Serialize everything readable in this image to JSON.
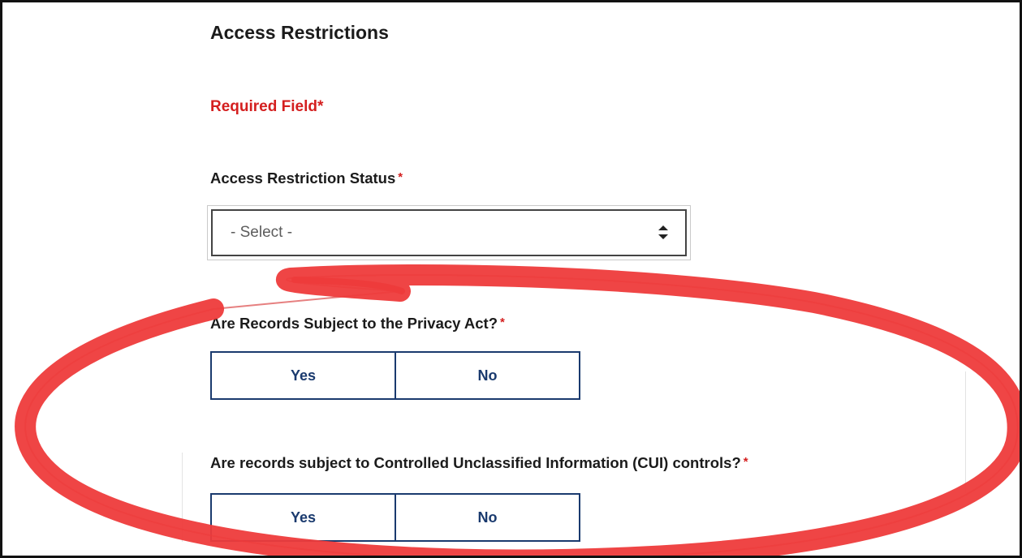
{
  "section": {
    "title": "Access Restrictions"
  },
  "required_note": {
    "text": "Required Field*",
    "color": "#d41f1f"
  },
  "access_status": {
    "label": "Access Restriction Status",
    "required_marker": "*",
    "selected_value": "- Select -"
  },
  "privacy_act": {
    "label": "Are Records Subject to the Privacy Act?",
    "required_marker": "*",
    "options": [
      "Yes",
      "No"
    ]
  },
  "cui": {
    "label": "Are records subject to Controlled Unclassified Information (CUI) controls?",
    "required_marker": "*",
    "options": [
      "Yes",
      "No"
    ]
  },
  "colors": {
    "required": "#d41f1f",
    "button_text": "#1a3a6e",
    "annotation": "#ee3b3b"
  },
  "icons": {
    "select_arrows": "sort-up-down-icon"
  }
}
